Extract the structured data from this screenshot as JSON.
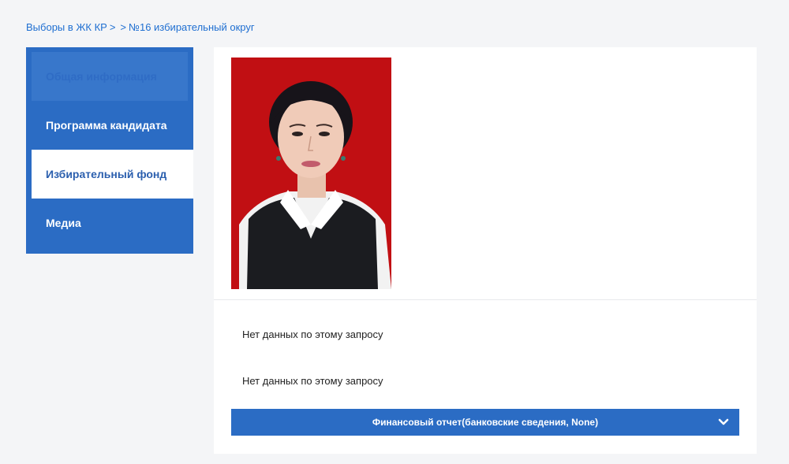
{
  "breadcrumb": {
    "root": "Выборы в ЖК КР",
    "sep1": ">",
    "sep2": ">",
    "current": "№16 избирательный округ"
  },
  "sidebar": {
    "items": [
      {
        "label": "Общая информация",
        "state": "faded"
      },
      {
        "label": "Программа кандидата",
        "state": "normal"
      },
      {
        "label": "Избирательный фонд",
        "state": "active"
      },
      {
        "label": "Медиа",
        "state": "normal"
      }
    ]
  },
  "main": {
    "nodata_1": "Нет данных по этому запросу",
    "nodata_2": "Нет данных по этому запросу",
    "accordion_label": "Финансовый отчет(банковские сведения, None)",
    "accordion_icon": "chevron-down-icon"
  },
  "colors": {
    "accent": "#2b6cc4",
    "link": "#1f6fd1",
    "photo_bg": "#c10f13"
  }
}
